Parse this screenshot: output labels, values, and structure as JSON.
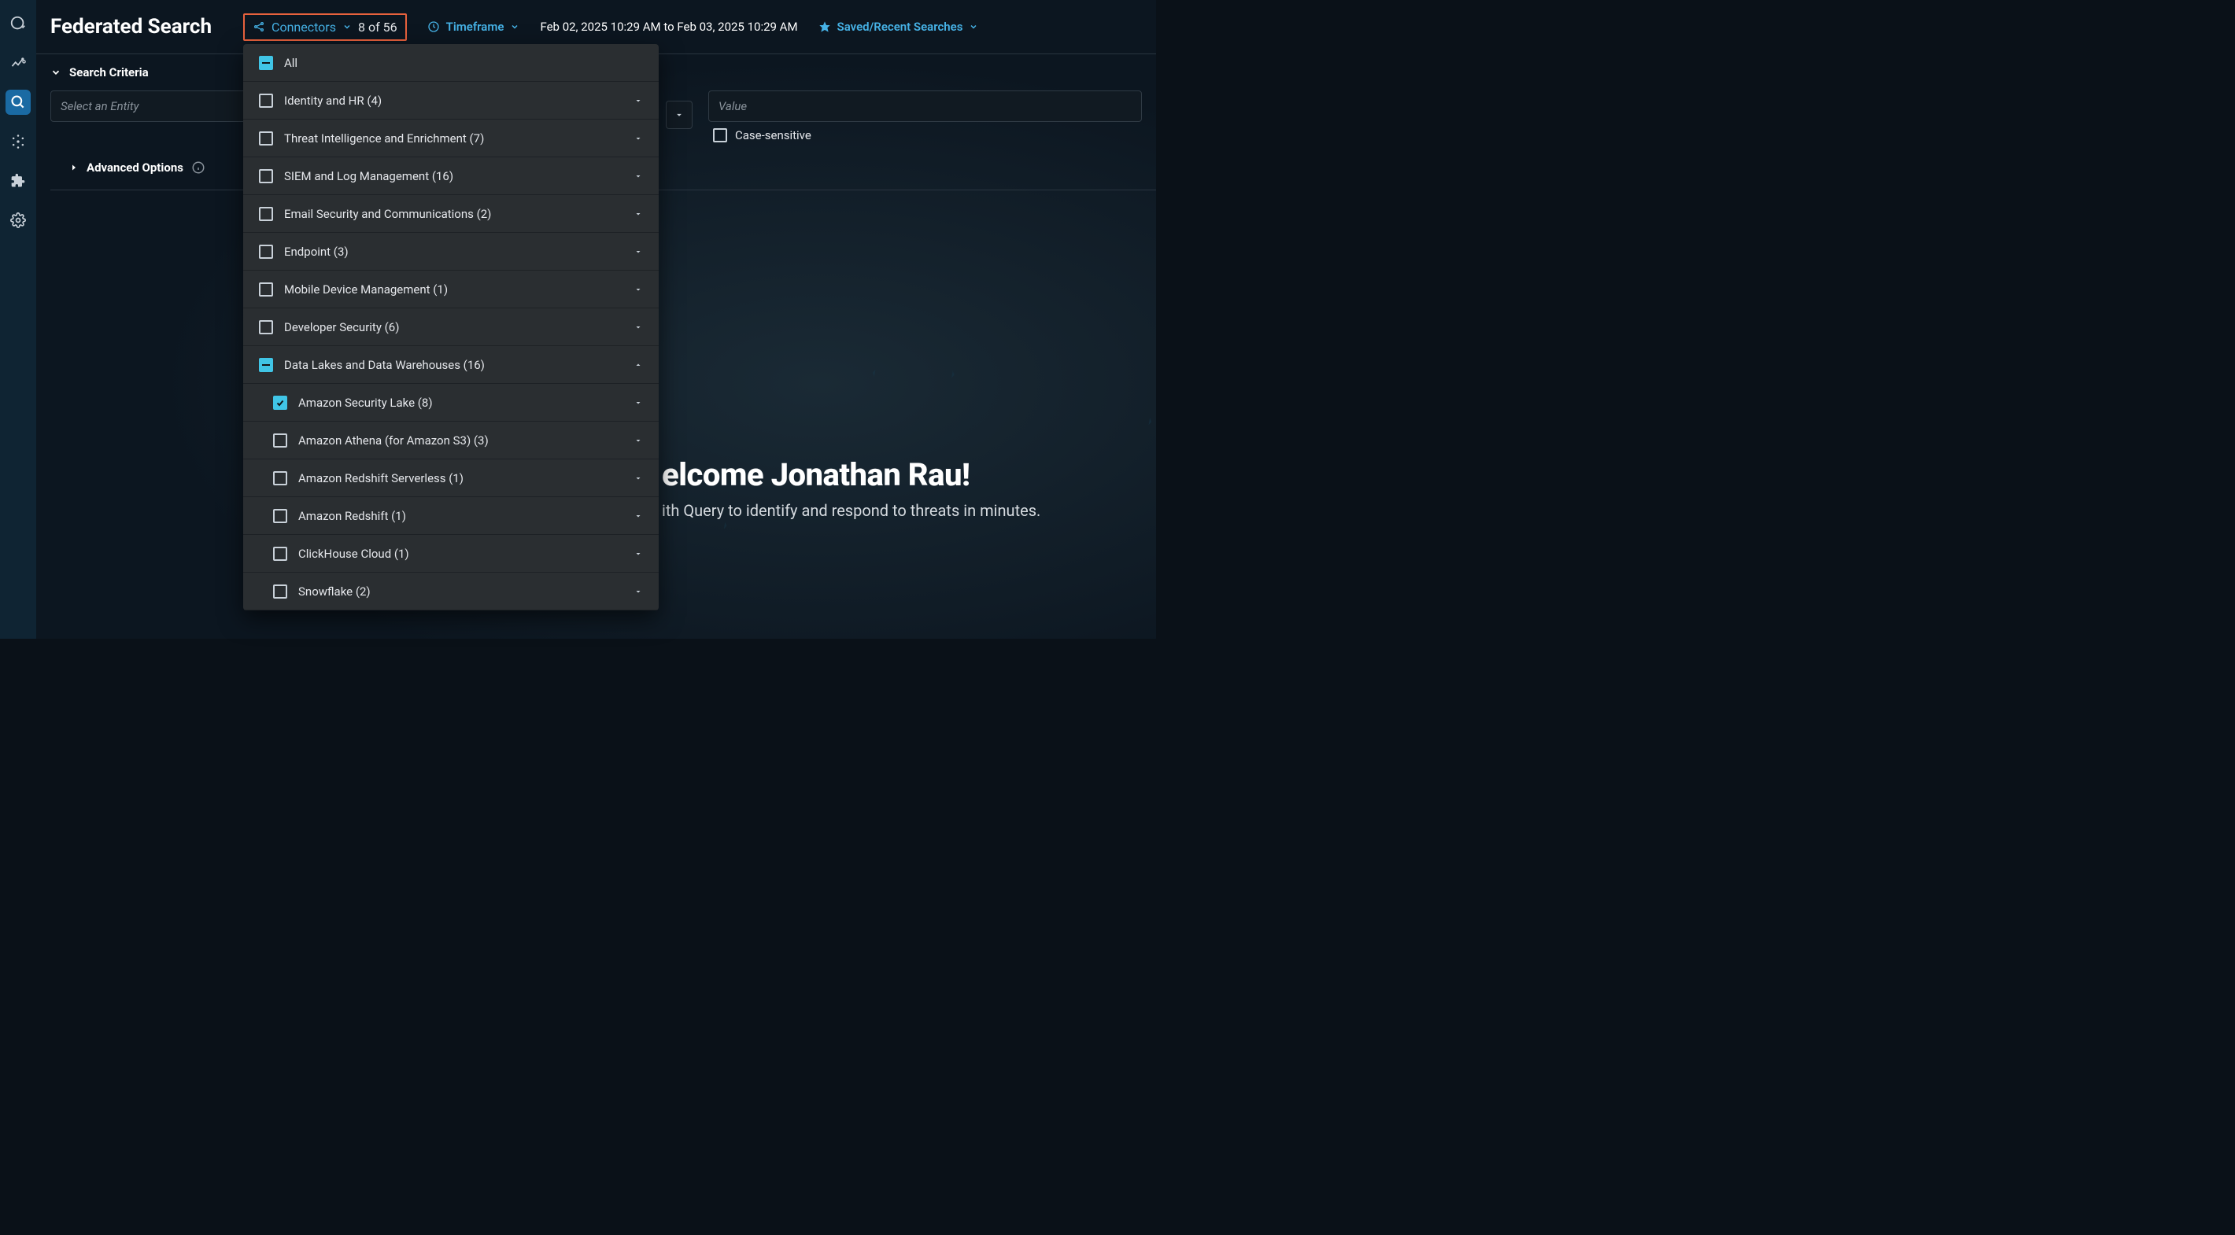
{
  "page_title": "Federated Search",
  "toolbar": {
    "connectors_label": "Connectors",
    "connectors_count": "8 of 56",
    "timeframe_label": "Timeframe",
    "timeframe_value": "Feb 02, 2025 10:29 AM to Feb 03, 2025 10:29 AM",
    "saved_label": "Saved/Recent Searches"
  },
  "criteria": {
    "header": "Search Criteria",
    "entity_placeholder": "Select an Entity",
    "value_placeholder": "Value",
    "case_sensitive_label": "Case-sensitive",
    "advanced_label": "Advanced Options"
  },
  "dropdown": {
    "all_label": "All",
    "groups": [
      {
        "label": "Identity and HR (4)"
      },
      {
        "label": "Threat Intelligence and Enrichment (7)"
      },
      {
        "label": "SIEM and Log Management (16)"
      },
      {
        "label": "Email Security and Communications (2)"
      },
      {
        "label": "Endpoint (3)"
      },
      {
        "label": "Mobile Device Management (1)"
      },
      {
        "label": "Developer Security (6)"
      }
    ],
    "expanded_label": "Data Lakes and Data Warehouses (16)",
    "children": [
      {
        "label": "Amazon Security Lake (8)",
        "checked": true
      },
      {
        "label": "Amazon Athena (for Amazon S3) (3)",
        "checked": false
      },
      {
        "label": "Amazon Redshift Serverless (1)",
        "checked": false
      },
      {
        "label": "Amazon Redshift (1)",
        "checked": false
      },
      {
        "label": "ClickHouse Cloud (1)",
        "checked": false
      },
      {
        "label": "Snowflake (2)",
        "checked": false
      }
    ]
  },
  "welcome": {
    "title": "elcome Jonathan Rau!",
    "sub": "ith Query to identify and respond to threats in minutes."
  }
}
